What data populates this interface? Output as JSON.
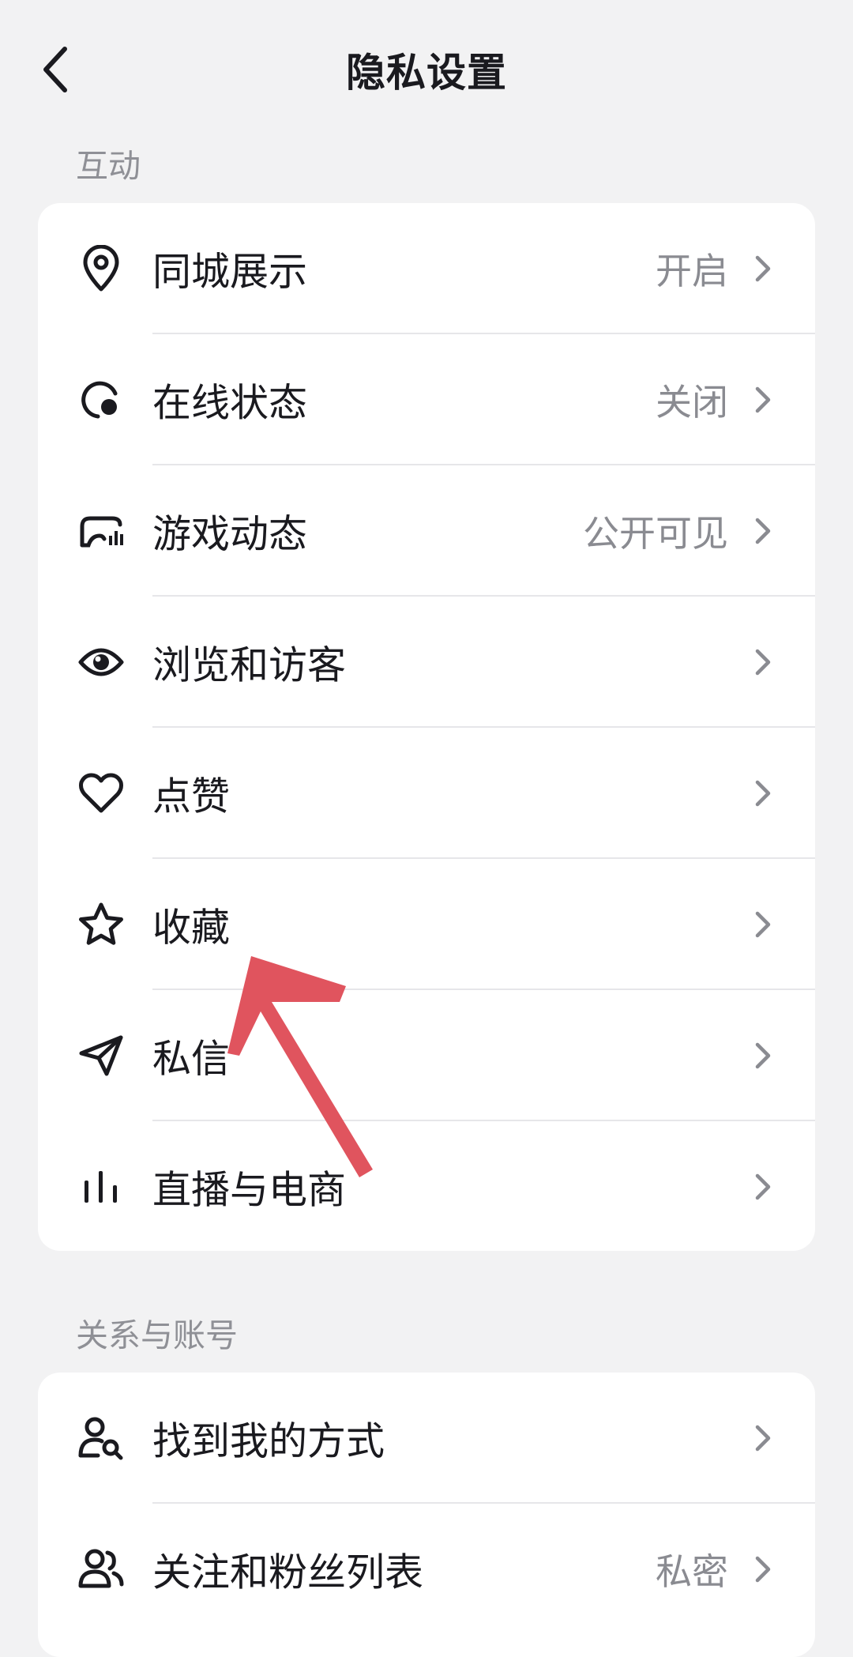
{
  "header": {
    "title": "隐私设置",
    "back_icon": "chevron-left-icon"
  },
  "sections": [
    {
      "title": "互动",
      "items": [
        {
          "label": "同城展示",
          "value": "开启",
          "icon": "location-pin-icon"
        },
        {
          "label": "在线状态",
          "value": "关闭",
          "icon": "online-status-icon"
        },
        {
          "label": "游戏动态",
          "value": "公开可见",
          "icon": "gamepad-icon"
        },
        {
          "label": "浏览和访客",
          "value": "",
          "icon": "eye-icon"
        },
        {
          "label": "点赞",
          "value": "",
          "icon": "heart-icon"
        },
        {
          "label": "收藏",
          "value": "",
          "icon": "star-icon"
        },
        {
          "label": "私信",
          "value": "",
          "icon": "paper-plane-icon"
        },
        {
          "label": "直播与电商",
          "value": "",
          "icon": "bar-chart-icon"
        }
      ]
    },
    {
      "title": "关系与账号",
      "items": [
        {
          "label": "找到我的方式",
          "value": "",
          "icon": "user-search-icon"
        },
        {
          "label": "关注和粉丝列表",
          "value": "私密",
          "icon": "users-icon"
        }
      ]
    }
  ],
  "colors": {
    "background": "#f2f2f3",
    "card": "#ffffff",
    "annotation_arrow": "#e0545e",
    "secondary_text": "#8a8b91"
  }
}
